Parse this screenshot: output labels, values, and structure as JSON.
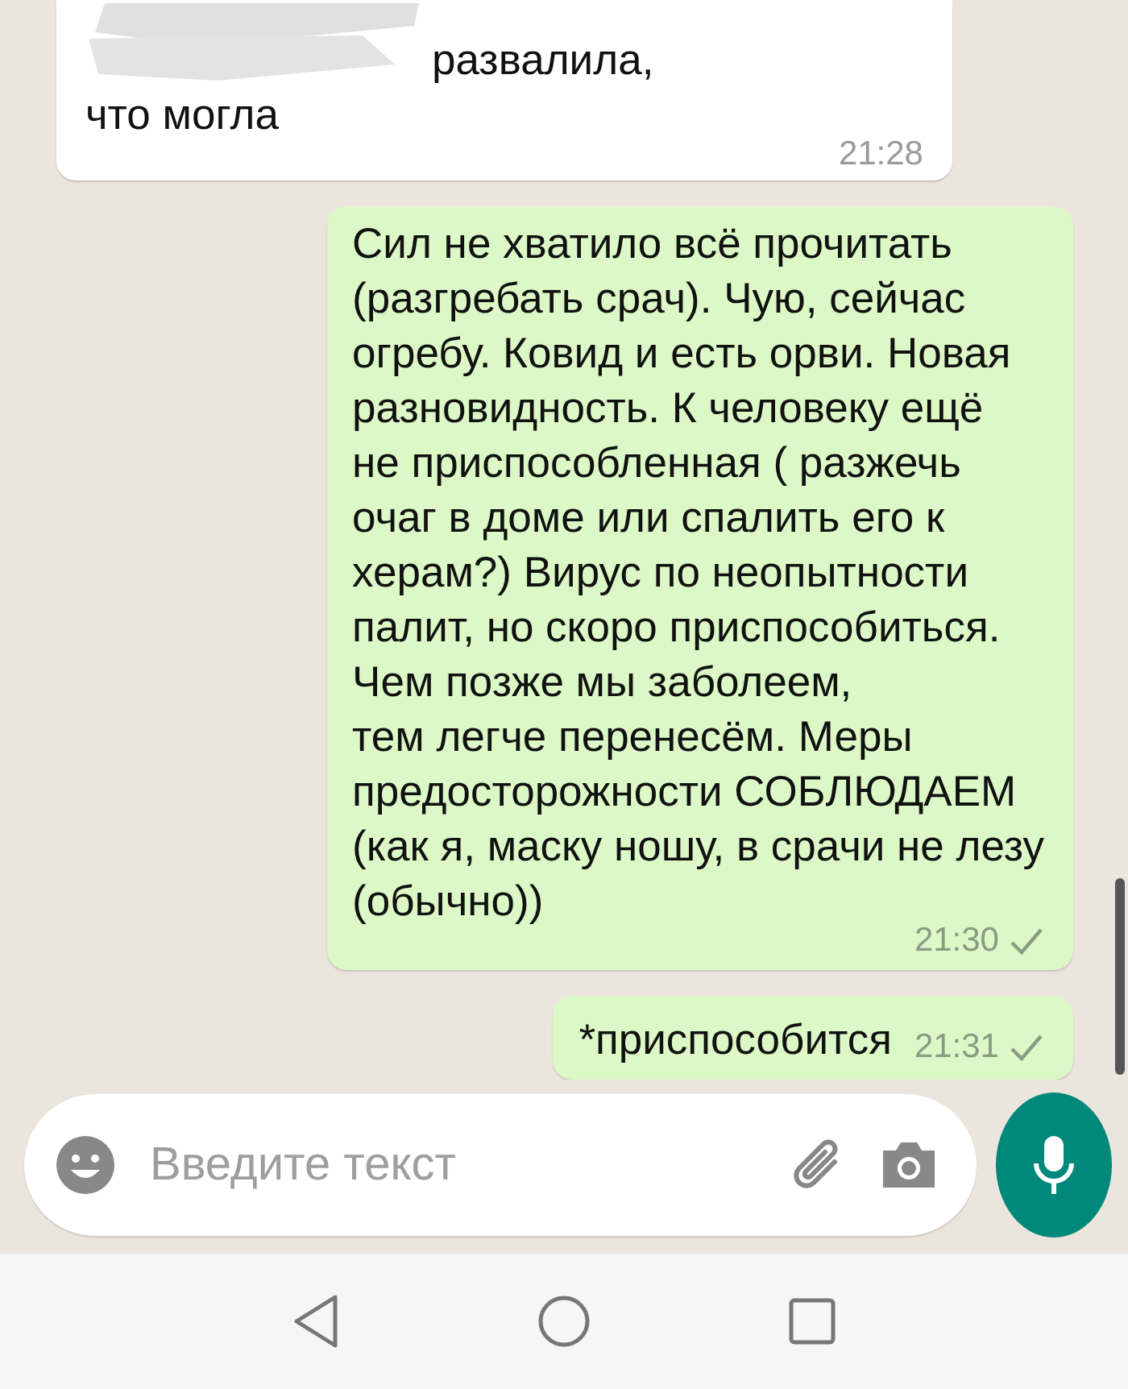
{
  "messages": [
    {
      "kind": "incoming",
      "text": "развалила,\nчто могла",
      "time": "21:28",
      "redacted": true
    },
    {
      "kind": "outgoing",
      "text": "Сил не хватило всё прочитать\n(разгребать срач). Чую, сейчас\nогребу. Ковид и есть орви. Новая\nразновидность. К человеку ещё\nне приспособленная ( разжечь\nочаг в доме или спалить его к\nхерам?) Вирус по неопытности\nпалит, но скоро приспособиться.\nЧем позже мы заболеем,\nтем легче перенесём. Меры\nпредосторожности СОБЛЮДАЕМ\n(как я, маску ношу, в срачи не лезу\n(обычно))",
      "time": "21:30",
      "delivered": true
    },
    {
      "kind": "outgoing",
      "text": "*приспособится",
      "time": "21:31",
      "delivered": true,
      "inline": true
    }
  ],
  "composer": {
    "placeholder": "Введите текст"
  }
}
